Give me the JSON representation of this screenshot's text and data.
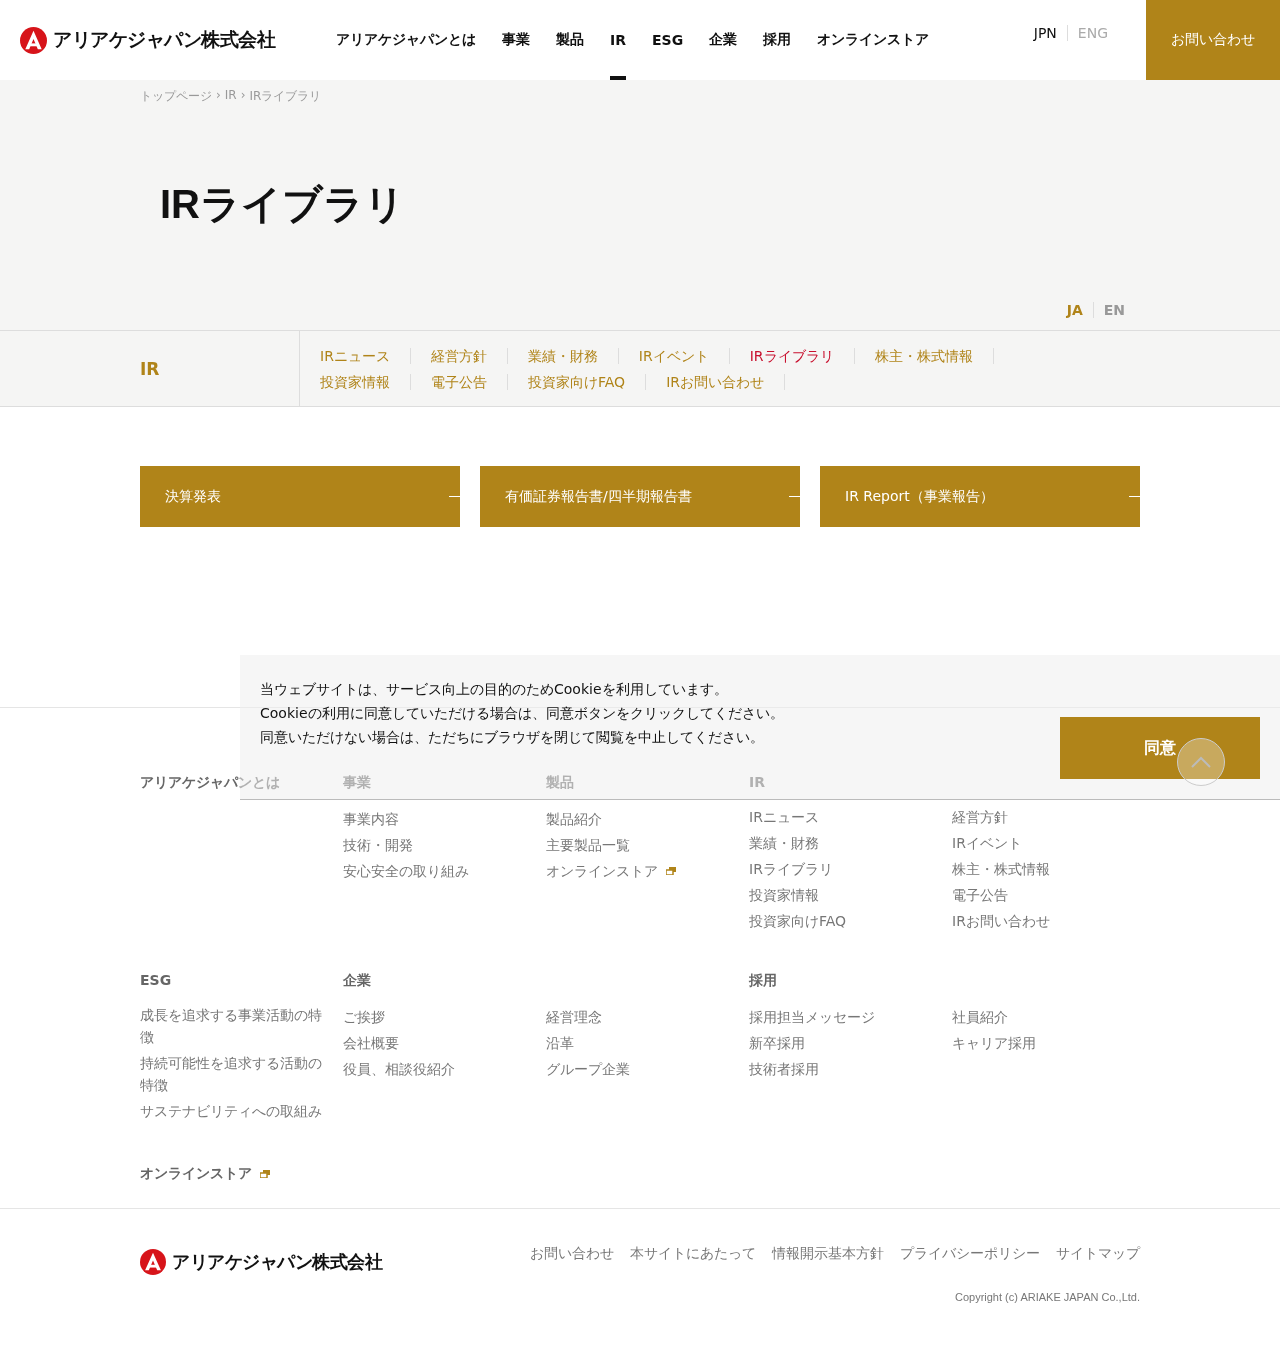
{
  "header": {
    "logo": "アリアケジャパン株式会社",
    "nav": [
      {
        "label": "アリアケジャパンとは",
        "selected": false
      },
      {
        "label": "事業",
        "selected": false
      },
      {
        "label": "製品",
        "selected": false
      },
      {
        "label": "IR",
        "selected": true
      },
      {
        "label": "ESG",
        "selected": false
      },
      {
        "label": "企業",
        "selected": false
      },
      {
        "label": "採用",
        "selected": false
      },
      {
        "label": "オンラインストア",
        "selected": false
      }
    ],
    "languages": [
      {
        "label": "JPN",
        "selected": true
      },
      {
        "label": "ENG",
        "selected": false
      }
    ],
    "contact_button": "お問い合わせ"
  },
  "breadcrumb": {
    "separator": "›",
    "items": [
      "トップページ",
      "IR",
      "IRライブラリ"
    ]
  },
  "page_title": "IRライブラリ",
  "content_languages": [
    {
      "label": "JA",
      "selected": true
    },
    {
      "label": "EN",
      "selected": false
    }
  ],
  "subnav": {
    "title": "IR",
    "rows": [
      [
        {
          "label": "IRニュース",
          "selected": false
        },
        {
          "label": "経営方針",
          "selected": false
        },
        {
          "label": "業績・財務",
          "selected": false
        },
        {
          "label": "IRイベント",
          "selected": false
        },
        {
          "label": "IRライブラリ",
          "selected": true
        },
        {
          "label": "株主・株式情報",
          "selected": false
        }
      ],
      [
        {
          "label": "投資家情報",
          "selected": false
        },
        {
          "label": "電子公告",
          "selected": false
        },
        {
          "label": "投資家向けFAQ",
          "selected": false
        },
        {
          "label": "IRお問い合わせ",
          "selected": false
        }
      ]
    ]
  },
  "library_buttons": [
    "決算発表",
    "有価証券報告書/四半期報告書",
    "IR Report（事業報告）"
  ],
  "footer": {
    "sections": [
      {
        "heading": "アリアケジャパンとは"
      },
      {
        "heading": "事業",
        "columns": [
          [
            {
              "label": "事業内容",
              "external": false
            },
            {
              "label": "技術・開発",
              "external": false
            },
            {
              "label": "安心安全の取り組み",
              "external": false
            }
          ]
        ]
      },
      {
        "heading": "製品",
        "columns": [
          [
            {
              "label": "製品紹介",
              "external": false
            },
            {
              "label": "主要製品一覧",
              "external": false
            },
            {
              "label": "オンラインストア",
              "external": true
            }
          ]
        ]
      },
      {
        "heading": "IR",
        "columns": [
          [
            {
              "label": "IRニュース",
              "external": false
            },
            {
              "label": "業績・財務",
              "external": false
            },
            {
              "label": "IRライブラリ",
              "external": false
            },
            {
              "label": "投資家情報",
              "external": false
            },
            {
              "label": "投資家向けFAQ",
              "external": false
            }
          ],
          [
            {
              "label": "経営方針",
              "external": false
            },
            {
              "label": "IRイベント",
              "external": false
            },
            {
              "label": "株主・株式情報",
              "external": false
            },
            {
              "label": "電子公告",
              "external": false
            },
            {
              "label": "IRお問い合わせ",
              "external": false
            }
          ]
        ]
      },
      {
        "heading": "ESG",
        "columns": [
          [
            {
              "label": "成長を追求する事業活動の特徴",
              "external": false
            },
            {
              "label": "持続可能性を追求する活動の特徴",
              "external": false
            },
            {
              "label": "サステナビリティへの取組み",
              "external": false
            }
          ]
        ]
      },
      {
        "heading": "企業",
        "columns": [
          [
            {
              "label": "ご挨拶",
              "external": false
            },
            {
              "label": "会社概要",
              "external": false
            },
            {
              "label": "役員、相談役紹介",
              "external": false
            }
          ],
          [
            {
              "label": "経営理念",
              "external": false
            },
            {
              "label": "沿革",
              "external": false
            },
            {
              "label": "グループ企業",
              "external": false
            }
          ]
        ]
      },
      {
        "heading": "採用",
        "columns": [
          [
            {
              "label": "採用担当メッセージ",
              "external": false
            },
            {
              "label": "新卒採用",
              "external": false
            },
            {
              "label": "技術者採用",
              "external": false
            }
          ],
          [
            {
              "label": "社員紹介",
              "external": false
            },
            {
              "label": "キャリア採用",
              "external": false
            }
          ]
        ]
      }
    ],
    "store_link": {
      "label": "オンラインストア",
      "external": true
    },
    "logo": "アリアケジャパン株式会社",
    "links": [
      "お問い合わせ",
      "本サイトにあたって",
      "情報開示基本方針",
      "プライバシーポリシー",
      "サイトマップ"
    ],
    "copyright": "Copyright (c) ARIAKE JAPAN Co.,Ltd."
  },
  "cookie_banner": {
    "lines": [
      "当ウェブサイトは、サービス向上の目的のためCookieを利用しています。",
      "Cookieの利用に同意していただける場合は、同意ボタンをクリックしてください。",
      "同意いただけない場合は、ただちにブラウザを閉じて閲覧を中止してください。"
    ],
    "agree_button": "同意"
  }
}
